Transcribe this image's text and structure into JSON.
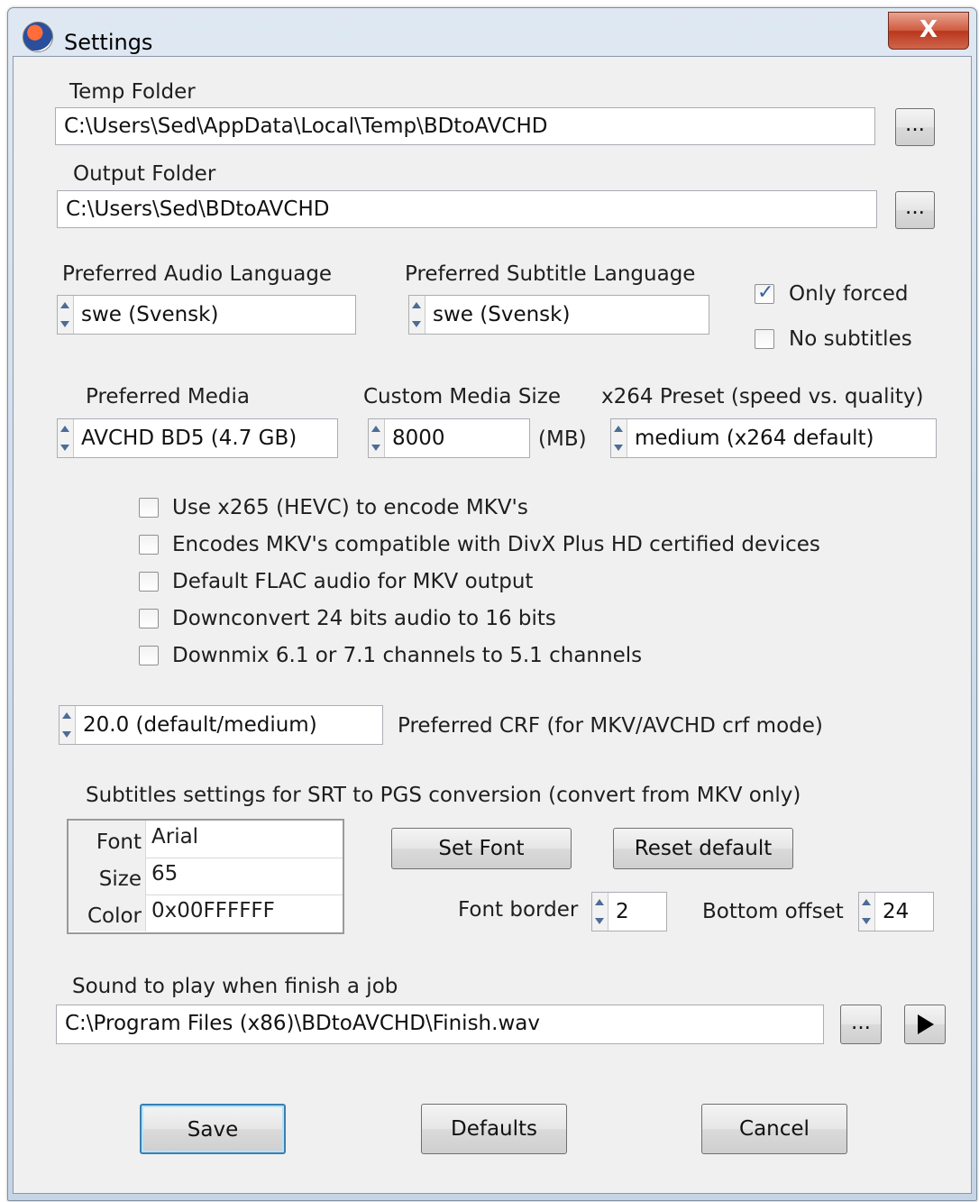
{
  "window": {
    "title": "Settings",
    "close_label": "X"
  },
  "temp_folder": {
    "label": "Temp Folder",
    "value": "C:\\Users\\Sed\\AppData\\Local\\Temp\\BDtoAVCHD",
    "browse_label": "..."
  },
  "output_folder": {
    "label": "Output Folder",
    "value": "C:\\Users\\Sed\\BDtoAVCHD",
    "browse_label": "..."
  },
  "audio_language": {
    "label": "Preferred Audio Language",
    "value": "swe (Svensk)"
  },
  "subtitle_language": {
    "label": "Preferred Subtitle Language",
    "value": "swe (Svensk)"
  },
  "only_forced": {
    "label": "Only forced",
    "checked": true
  },
  "no_subtitles": {
    "label": "No subtitles",
    "checked": false
  },
  "media": {
    "label": "Preferred Media",
    "value": "AVCHD BD5 (4.7 GB)"
  },
  "custom_size": {
    "label": "Custom Media Size",
    "value": "8000",
    "unit": "(MB)"
  },
  "x264_preset": {
    "label": "x264 Preset (speed vs. quality)",
    "value": "medium (x264 default)"
  },
  "options": [
    {
      "label": "Use x265 (HEVC) to encode MKV's",
      "checked": false
    },
    {
      "label": "Encodes MKV's compatible with DivX Plus HD certified devices",
      "checked": false
    },
    {
      "label": "Default FLAC audio for MKV output",
      "checked": false
    },
    {
      "label": "Downconvert 24 bits audio to 16 bits",
      "checked": false
    },
    {
      "label": "Downmix 6.1 or 7.1 channels to 5.1 channels",
      "checked": false
    }
  ],
  "crf": {
    "value": "20.0 (default/medium)",
    "label": "Preferred CRF (for MKV/AVCHD crf mode)"
  },
  "subtitles": {
    "heading": "Subtitles settings for SRT to PGS conversion (convert from MKV only)",
    "rows": [
      {
        "key": "Font",
        "value": "Arial"
      },
      {
        "key": "Size",
        "value": "65"
      },
      {
        "key": "Color",
        "value": "0x00FFFFFF"
      }
    ],
    "set_font_label": "Set Font",
    "reset_default_label": "Reset default",
    "font_border_label": "Font border",
    "font_border_value": "2",
    "bottom_offset_label": "Bottom offset",
    "bottom_offset_value": "24"
  },
  "sound": {
    "label": "Sound to play when finish a job",
    "value": "C:\\Program Files (x86)\\BDtoAVCHD\\Finish.wav",
    "browse_label": "..."
  },
  "buttons": {
    "save": "Save",
    "defaults": "Defaults",
    "cancel": "Cancel"
  }
}
